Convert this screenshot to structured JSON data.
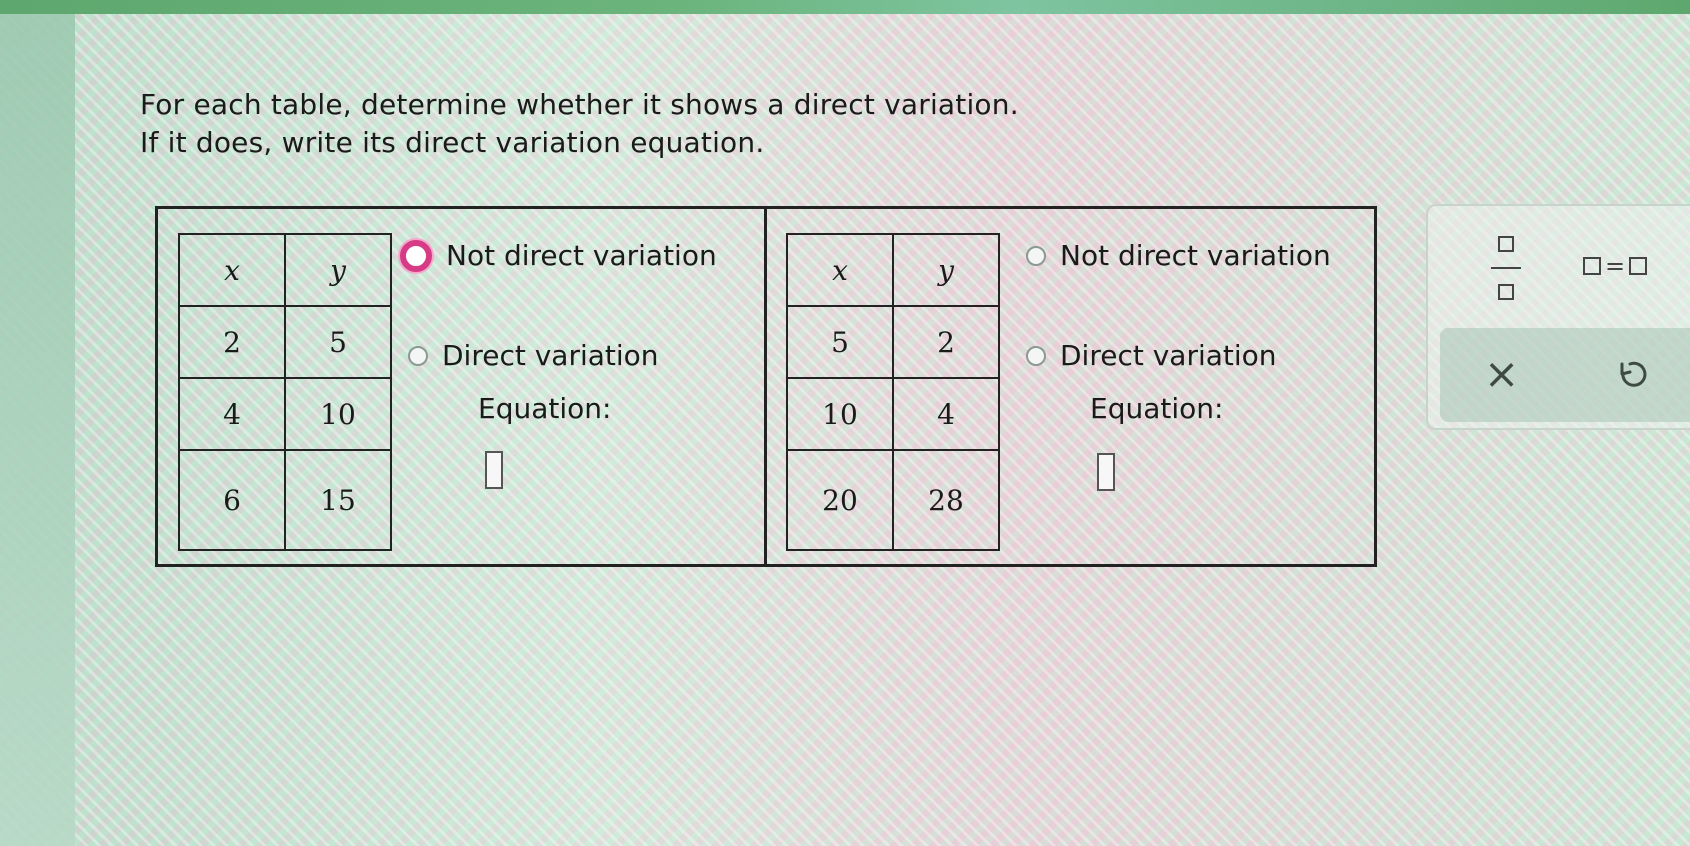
{
  "instructions": {
    "line1": "For each table, determine whether it shows a direct variation.",
    "line2": "If it does, write its direct variation equation."
  },
  "tables": [
    {
      "headers": [
        "x",
        "y"
      ],
      "rows": [
        [
          "2",
          "5"
        ],
        [
          "4",
          "10"
        ],
        [
          "6",
          "15"
        ]
      ],
      "options": {
        "not_direct": "Not direct variation",
        "direct": "Direct variation"
      },
      "equation_label": "Equation:"
    },
    {
      "headers": [
        "x",
        "y"
      ],
      "rows": [
        [
          "5",
          "2"
        ],
        [
          "10",
          "4"
        ],
        [
          "20",
          "28"
        ]
      ],
      "options": {
        "not_direct": "Not direct variation",
        "direct": "Direct variation"
      },
      "equation_label": "Equation:"
    }
  ],
  "toolbar": {
    "equals_symbol": "=",
    "clear_symbol": "×"
  },
  "colors": {
    "focus_ring": "#d63c86",
    "top_strip": "#5ea86f"
  },
  "icons": [
    "fraction-icon",
    "equation-icon",
    "clear-icon",
    "undo-icon",
    "radio-icon"
  ]
}
